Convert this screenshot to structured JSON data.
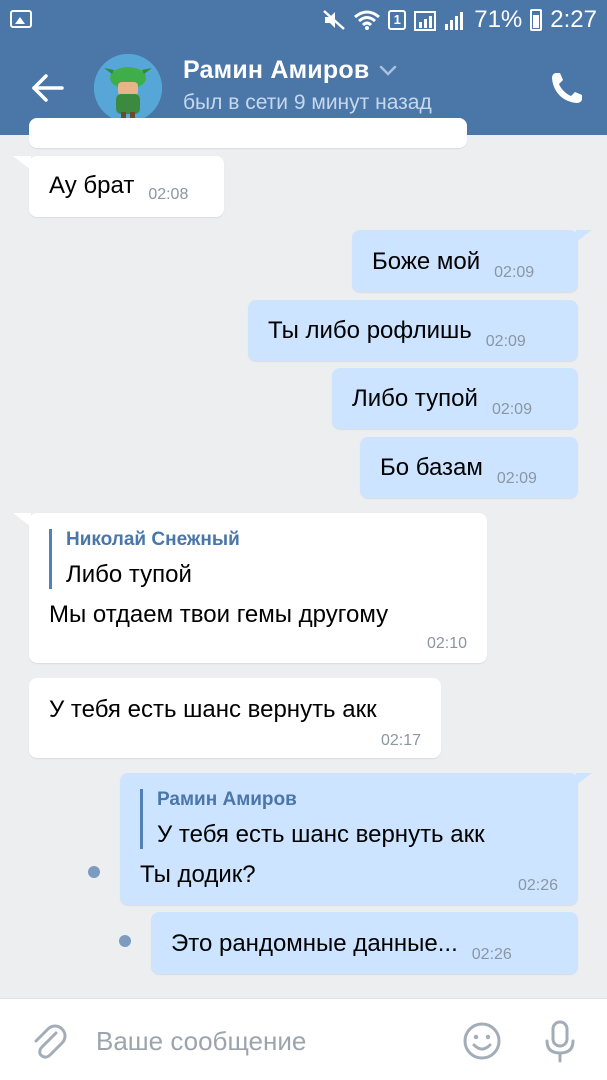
{
  "status_bar": {
    "badge": "1",
    "battery": "71%",
    "time": "2:27"
  },
  "header": {
    "name": "Рамин Амиров",
    "status": "был в сети 9 минут назад"
  },
  "messages": [
    {
      "direction": "in",
      "text": "Ау брат",
      "time": "02:08"
    },
    {
      "direction": "out",
      "text": "Боже мой",
      "time": "02:09"
    },
    {
      "direction": "out",
      "text": "Ты либо рофлишь",
      "time": "02:09"
    },
    {
      "direction": "out",
      "text": "Либо тупой",
      "time": "02:09"
    },
    {
      "direction": "out",
      "text": "Бо базам",
      "time": "02:09"
    },
    {
      "direction": "in",
      "quote_author": "Николай Снежный",
      "quote_text": "Либо тупой",
      "text": "Мы отдаем  твои гемы другому",
      "time": "02:10"
    },
    {
      "direction": "in",
      "text": "У тебя есть шанс вернуть акк",
      "time": "02:17"
    },
    {
      "direction": "out",
      "quote_author": "Рамин Амиров",
      "quote_text": "У тебя есть шанс вернуть акк",
      "text": "Ты додик?",
      "time": "02:26",
      "unread": true
    },
    {
      "direction": "out",
      "text": "Это рандомные данные...",
      "time": "02:26",
      "unread": true
    }
  ],
  "input": {
    "placeholder": "Ваше сообщение"
  },
  "colors": {
    "header": "#4a76a8",
    "outgoing_bubble": "#cce4ff",
    "incoming_bubble": "#ffffff",
    "background": "#edeef0"
  }
}
